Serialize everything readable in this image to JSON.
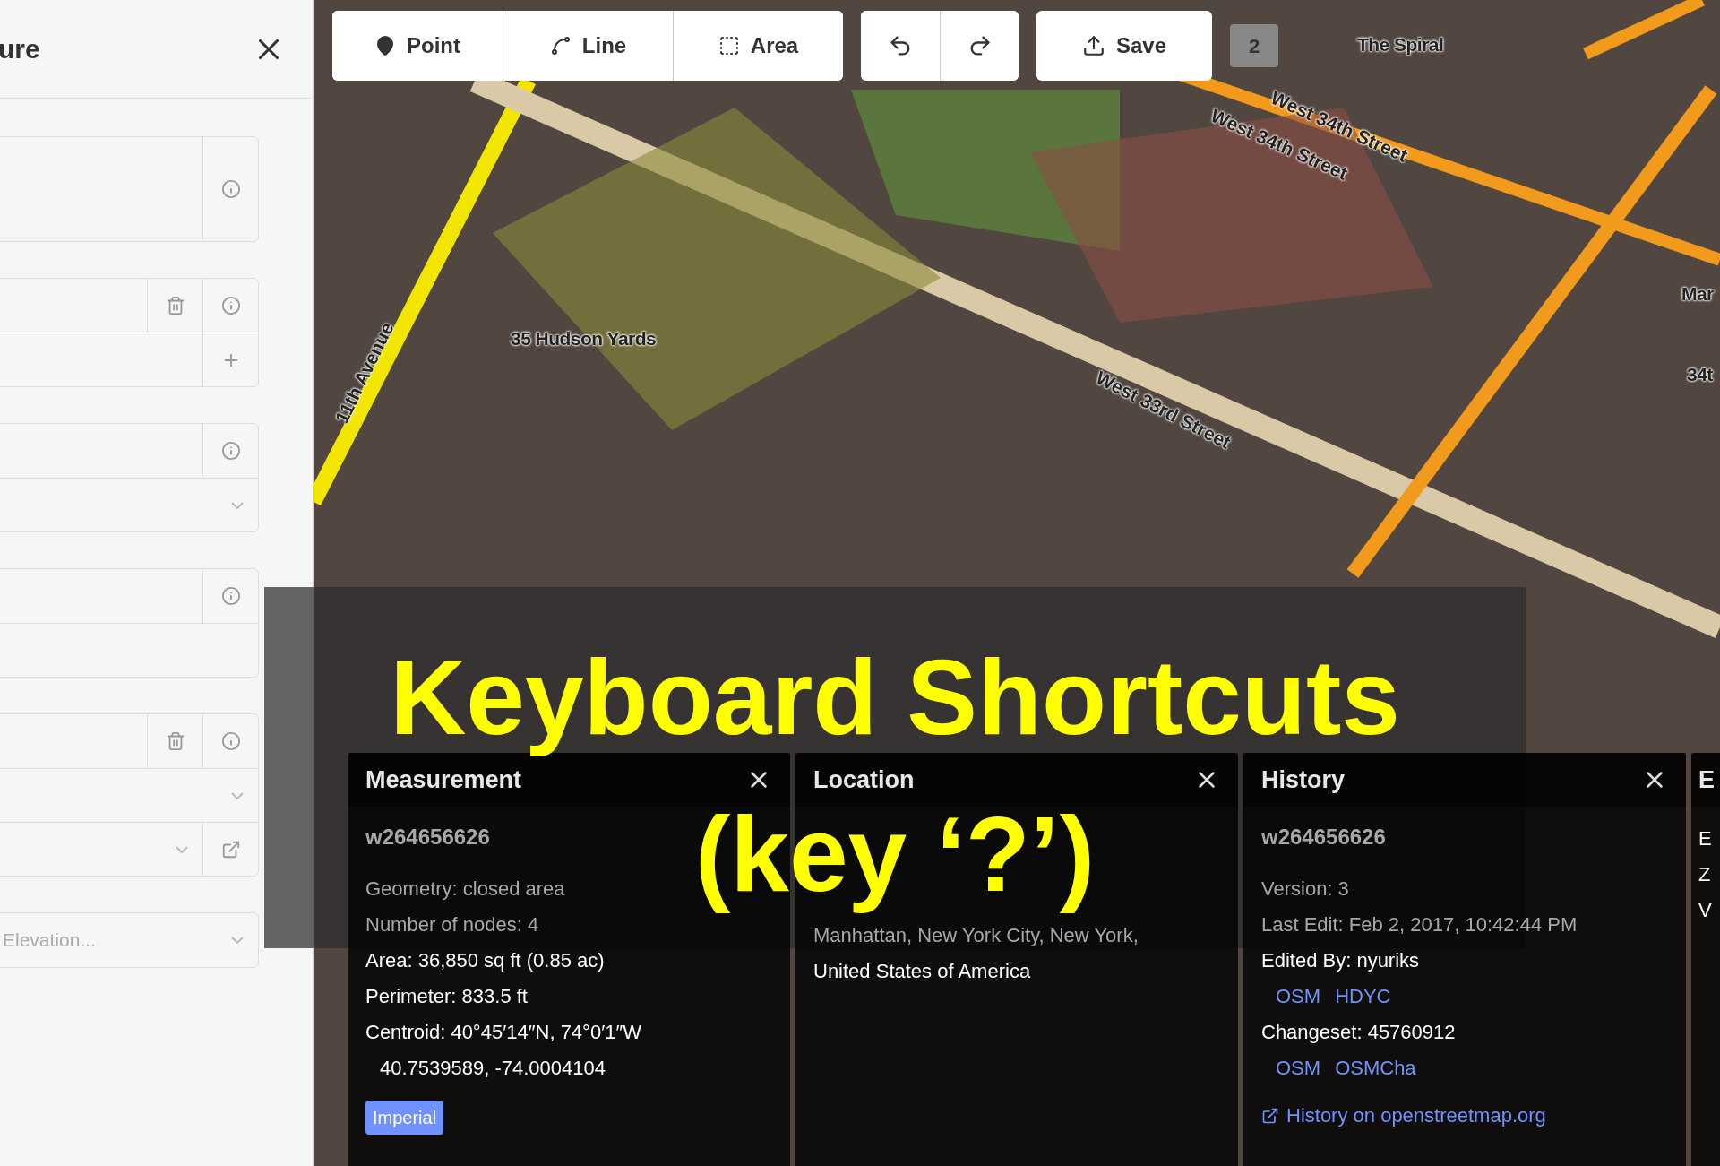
{
  "sidebar": {
    "title": "ure",
    "fields": [
      {
        "rows": [
          {
            "kind": "textarea",
            "actions": [
              {
                "kind": "info"
              }
            ]
          }
        ]
      },
      {
        "rows": [
          {
            "kind": "text",
            "actions": [
              {
                "kind": "delete"
              },
              {
                "kind": "info"
              }
            ]
          },
          {
            "kind": "text",
            "actions": [
              {
                "kind": "add"
              }
            ]
          }
        ]
      },
      {
        "rows": [
          {
            "kind": "text",
            "actions": [
              {
                "kind": "info"
              }
            ]
          },
          {
            "kind": "combo"
          }
        ]
      },
      {
        "rows": [
          {
            "kind": "text",
            "actions": [
              {
                "kind": "info"
              }
            ]
          },
          {
            "kind": "text"
          }
        ]
      },
      {
        "rows": [
          {
            "kind": "text",
            "actions": [
              {
                "kind": "delete"
              },
              {
                "kind": "info"
              }
            ]
          },
          {
            "kind": "combo"
          },
          {
            "kind": "combo",
            "actions": [
              {
                "kind": "link"
              }
            ]
          }
        ]
      },
      {
        "rows": [
          {
            "kind": "combo",
            "placeholder": "Elevation..."
          }
        ]
      }
    ]
  },
  "toolbar": {
    "modes": [
      {
        "kind": "point",
        "label": "Point"
      },
      {
        "kind": "line",
        "label": "Line"
      },
      {
        "kind": "area",
        "label": "Area"
      }
    ],
    "save": {
      "label": "Save"
    },
    "edit_count": "2"
  },
  "map": {
    "labels": [
      {
        "text": "The Spiral",
        "kind": "place"
      },
      {
        "text": "West 34th Street",
        "kind": "street"
      },
      {
        "text": "West 34th Street",
        "kind": "street"
      },
      {
        "text": "11th Avenue",
        "kind": "street"
      },
      {
        "text": "35 Hudson Yards",
        "kind": "place"
      },
      {
        "text": "West 33rd Street",
        "kind": "street"
      },
      {
        "text": "Mar",
        "kind": "place"
      },
      {
        "text": "34t",
        "kind": "place"
      }
    ]
  },
  "caption": {
    "lines": [
      "Keyboard Shortcuts",
      "(key ‘?’)"
    ]
  },
  "panels": [
    {
      "title": "Measurement",
      "heading": "w264656626",
      "rows": [
        {
          "kind": "dim",
          "label": "Geometry:",
          "value": "closed area"
        },
        {
          "kind": "dim",
          "label": "Number of nodes:",
          "value": "4"
        },
        {
          "kind": "plain",
          "label": "Area:",
          "value": "36,850 sq ft (0.85 ac)"
        },
        {
          "kind": "plain",
          "label": "Perimeter:",
          "value": "833.5 ft"
        },
        {
          "kind": "plain",
          "label": "Centroid:",
          "value": "40°45′14″N, 74°0′1″W"
        },
        {
          "kind": "indent",
          "value": "40.7539589, -74.0004104"
        },
        {
          "kind": "button",
          "value": "Imperial"
        }
      ]
    },
    {
      "title": "Location",
      "rows": [
        {
          "kind": "dim",
          "value": "Manhattan, New York City, New York,"
        },
        {
          "kind": "plain",
          "value": "United States of America"
        }
      ]
    },
    {
      "title": "History",
      "heading": "w264656626",
      "rows": [
        {
          "kind": "dim",
          "label": "Version:",
          "value": "3"
        },
        {
          "kind": "dim",
          "label": "Last Edit:",
          "value": "Feb 2, 2017, 10:42:44 PM"
        },
        {
          "kind": "plain",
          "label": "Edited By:",
          "value": "nyuriks"
        },
        {
          "kind": "links",
          "links": [
            "OSM",
            "HDYC"
          ]
        },
        {
          "kind": "plain",
          "label": "Changeset:",
          "value": "45760912"
        },
        {
          "kind": "links",
          "links": [
            "OSM",
            "OSMCha"
          ]
        },
        {
          "kind": "external",
          "value": "History on openstreetmap.org"
        }
      ]
    },
    {
      "title": "E",
      "rows": [
        {
          "kind": "plain",
          "value": "E"
        },
        {
          "kind": "plain",
          "value": "Z"
        },
        {
          "kind": "plain",
          "value": "V"
        }
      ]
    }
  ]
}
